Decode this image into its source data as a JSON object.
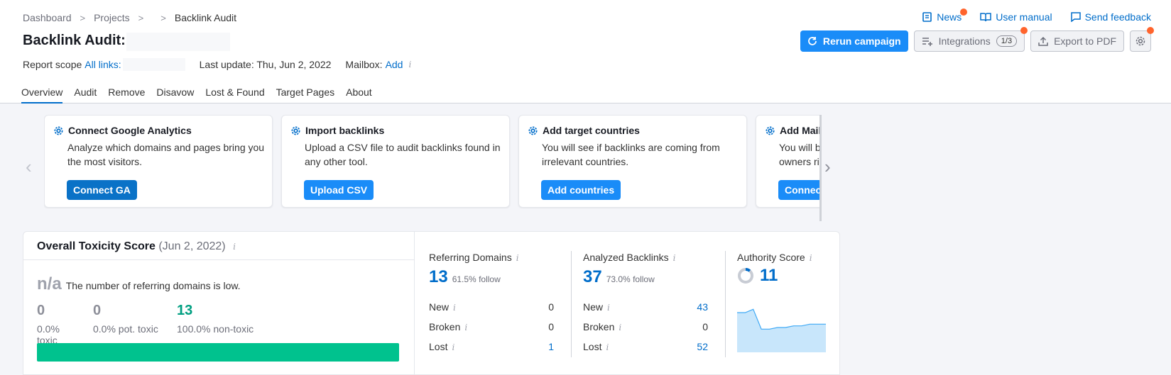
{
  "breadcrumb": {
    "items": [
      "Dashboard",
      "Projects",
      "Backlink Audit"
    ]
  },
  "title": "Backlink Audit:",
  "scope": {
    "label": "Report scope",
    "link": "All links:",
    "last_update": "Last update: Thu, Jun 2, 2022",
    "mailbox_label": "Mailbox:",
    "mailbox_link": "Add",
    "info": "i"
  },
  "top_links": {
    "news": "News",
    "manual": "User manual",
    "feedback": "Send feedback"
  },
  "actions": {
    "rerun": "Rerun campaign",
    "integrations": "Integrations",
    "integrations_count": "1/3",
    "export": "Export to PDF"
  },
  "tabs": [
    "Overview",
    "Audit",
    "Remove",
    "Disavow",
    "Lost & Found",
    "Target Pages",
    "About"
  ],
  "cards": [
    {
      "title": "Connect Google Analytics",
      "text": "Analyze which domains and pages bring you the most visitors.",
      "button": "Connect GA"
    },
    {
      "title": "Import backlinks",
      "text": "Upload a CSV file to audit backlinks found in any other tool.",
      "button": "Upload CSV"
    },
    {
      "title": "Add target countries",
      "text": "You will see if backlinks are coming from irrelevant countries.",
      "button": "Add countries"
    },
    {
      "title": "Add Mail",
      "text": "You will b owners ri",
      "button": "Connec"
    }
  ],
  "toxicity": {
    "title": "Overall Toxicity Score",
    "date": "(Jun 2, 2022)",
    "na": "n/a",
    "na_text": "The number of referring domains is low.",
    "stats": [
      {
        "value": "0",
        "label": "0.0% toxic"
      },
      {
        "value": "0",
        "label": "0.0% pot. toxic"
      },
      {
        "value": "13",
        "label": "100.0% non-toxic"
      }
    ],
    "non_toxic_fraction": 1.0
  },
  "referring": {
    "title": "Referring Domains",
    "value": "13",
    "follow": "61.5% follow",
    "rows": [
      {
        "label": "New",
        "value": "0"
      },
      {
        "label": "Broken",
        "value": "0"
      },
      {
        "label": "Lost",
        "value": "1"
      }
    ]
  },
  "backlinks": {
    "title": "Analyzed Backlinks",
    "value": "37",
    "follow": "73.0% follow",
    "rows": [
      {
        "label": "New",
        "value": "43"
      },
      {
        "label": "Broken",
        "value": "0"
      },
      {
        "label": "Lost",
        "value": "52"
      }
    ]
  },
  "authority": {
    "title": "Authority Score",
    "value": "11",
    "trend": [
      12,
      12,
      13,
      7,
      7,
      7.5,
      7.5,
      8,
      8,
      8.5,
      8.5,
      8.5
    ]
  },
  "colors": {
    "accent": "#1a8cf8",
    "link": "#006dca",
    "green": "#00c28e",
    "notify": "#ff642d"
  }
}
